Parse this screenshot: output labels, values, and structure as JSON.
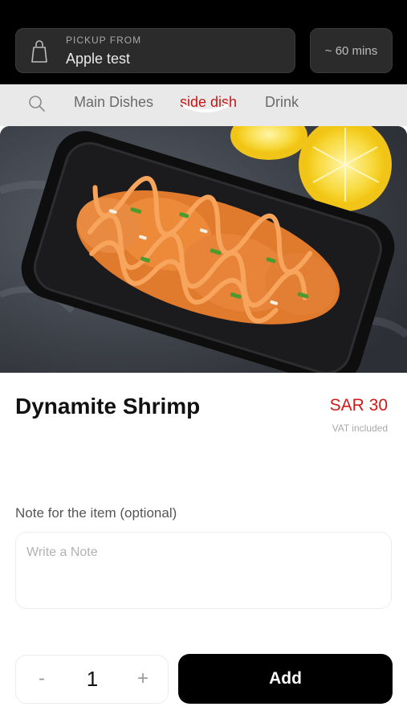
{
  "header": {
    "pickup_label": "PICKUP FROM",
    "pickup_value": "Apple test",
    "eta": "~ 60 mins"
  },
  "nav": {
    "tabs": [
      {
        "label": "Main Dishes",
        "active": false
      },
      {
        "label": "side dish",
        "active": true
      },
      {
        "label": "Drink",
        "active": false
      }
    ]
  },
  "product": {
    "name": "Dynamite Shrimp",
    "price": "SAR 30",
    "vat_note": "VAT included",
    "image": "dynamite-shrimp-photo"
  },
  "note": {
    "label": "Note for the item (optional)",
    "placeholder": "Write a Note",
    "value": ""
  },
  "order": {
    "minus": "-",
    "quantity": "1",
    "plus": "+",
    "add_label": "Add"
  },
  "colors": {
    "accent": "#d11717",
    "topbar": "#000000",
    "button": "#000000"
  }
}
